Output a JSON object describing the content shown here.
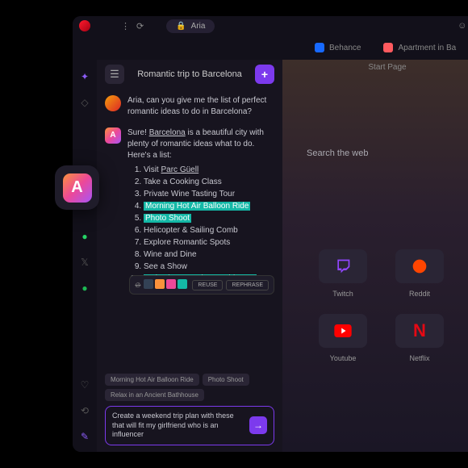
{
  "address_bar": {
    "label": "Aria"
  },
  "tabs": [
    {
      "label": "Behance"
    },
    {
      "label": "Apartment in Ba"
    }
  ],
  "start_page": "Start Page",
  "search_placeholder": "Search the web",
  "chat": {
    "title": "Romantic trip to Barcelona",
    "user_msg": "Aria, can you give me the list of perfect romantic ideas to do in Barcelona?",
    "aria_intro_1": "Sure! ",
    "aria_city": "Barcelona",
    "aria_intro_2": " is a beautiful city with plenty of romantic ideas what to do. Here's a list:",
    "list": [
      {
        "text_a": "Visit ",
        "text_b": "Parc Güell",
        "hl": false,
        "underline_b": true
      },
      {
        "text_a": "Take a Cooking Class",
        "hl": false
      },
      {
        "text_a": "Private Wine Tasting Tour",
        "hl": false
      },
      {
        "text_a": "Morning Hot Air Balloon Ride",
        "hl": true
      },
      {
        "text_a": "Photo Shoot",
        "hl": true
      },
      {
        "text_a": "Helicopter & Sailing Comb",
        "hl": false
      },
      {
        "text_a": "Explore Romantic Spots",
        "hl": false
      },
      {
        "text_a": "Wine and Dine",
        "hl": false
      },
      {
        "text_a": "See a Show",
        "hl": false
      },
      {
        "text_a": "Relax in an Ancient Bathhouse",
        "hl": true
      }
    ],
    "reuse_label": "REUSE",
    "rephrase_label": "REPHRASE",
    "chips": [
      "Morning Hot Air Balloon Ride",
      "Photo Shoot",
      "Relax in an Ancient Bathhouse"
    ],
    "input_text": "Create a weekend trip plan with these that will fit my girlfriend who is an influencer"
  },
  "speed_dial": [
    {
      "label": "Twitch",
      "color": "#9146ff"
    },
    {
      "label": "Reddit",
      "color": "#ff4500"
    },
    {
      "label": "Youtube",
      "color": "#ff0000"
    },
    {
      "label": "Netflix",
      "color": "#e50914"
    }
  ],
  "colors": {
    "swatches": [
      "#334155",
      "#fb923c",
      "#ec4899",
      "#14b8a6"
    ]
  }
}
